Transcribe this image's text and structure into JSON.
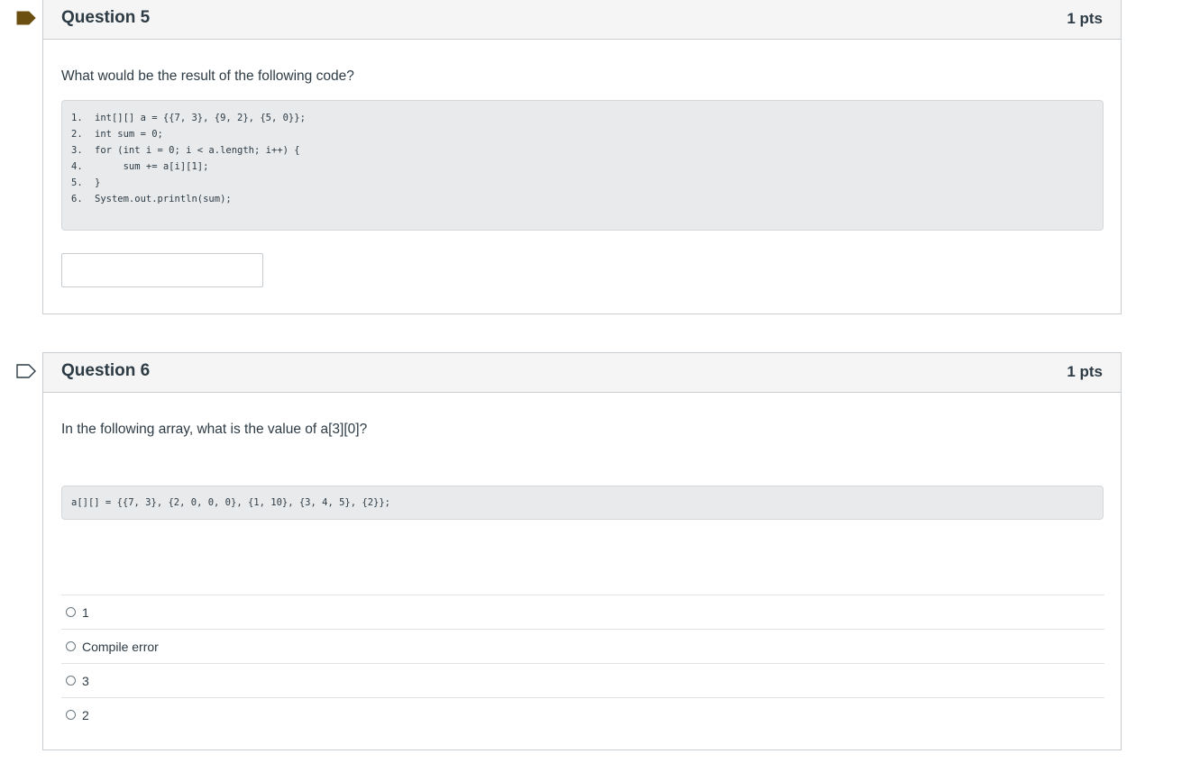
{
  "questions": [
    {
      "title": "Question 5",
      "points": "1 pts",
      "flagged": true,
      "prompt": "What would be the result of the following code?",
      "code_lines": [
        {
          "num": "1.",
          "code": "int[][] a = {{7, 3}, {9, 2}, {5, 0}};"
        },
        {
          "num": "2.",
          "code": "int sum = 0;"
        },
        {
          "num": "3.",
          "code": "for (int i = 0; i < a.length; i++) {"
        },
        {
          "num": "4.",
          "code": "     sum += a[i][1];"
        },
        {
          "num": "5.",
          "code": "}"
        },
        {
          "num": "6.",
          "code": "System.out.println(sum);"
        }
      ],
      "answer_value": ""
    },
    {
      "title": "Question 6",
      "points": "1 pts",
      "flagged": false,
      "prompt": "In the following array, what is the value of a[3][0]?",
      "code": "a[][] = {{7, 3}, {2, 0, 0, 0}, {1, 10}, {3, 4, 5}, {2}};",
      "choices": [
        "1",
        "Compile error",
        "3",
        "2"
      ]
    }
  ],
  "colors": {
    "flag_filled": "#6b4f10",
    "flag_outline": "#2d3b45",
    "header_bg": "#f5f5f5",
    "code_bg": "#e8eaec",
    "border": "#c7cdd1"
  },
  "icons": {
    "q5_flag": "flag-filled-icon",
    "q6_flag": "flag-outline-icon",
    "choice_marker": "radio-icon"
  }
}
